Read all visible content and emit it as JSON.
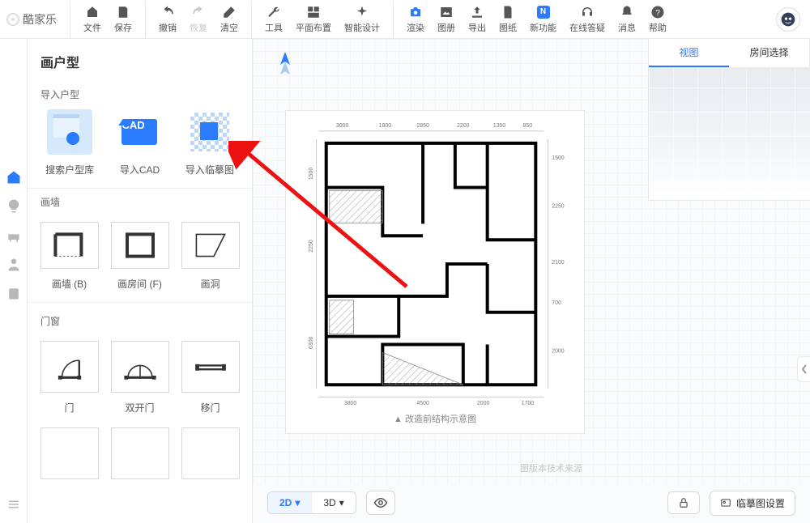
{
  "brand": "酷家乐",
  "toolbar": {
    "file": "文件",
    "save": "保存",
    "undo": "撤销",
    "redo": "恢复",
    "clear": "清空",
    "tools": "工具",
    "layout": "平面布置",
    "ai": "智能设计",
    "render": "渲染",
    "album": "图册",
    "export": "导出",
    "drawing": "图纸",
    "newfeat": "新功能",
    "qa": "在线答疑",
    "msg": "消息",
    "help": "帮助"
  },
  "panel": {
    "title": "画户型",
    "import_section": "导入户型",
    "cards": {
      "search_lib": "搜索户型库",
      "import_cad": "导入CAD",
      "import_trace": "导入临摹图",
      "cad_badge": "CAD"
    },
    "wall_section": "画墙",
    "wall_items": {
      "wall": "画墙 (B)",
      "room": "画房间 (F)",
      "opening": "画洞"
    },
    "door_section": "门窗",
    "door_items": {
      "single": "门",
      "double": "双开门",
      "sliding": "移门"
    }
  },
  "view_tabs": {
    "view": "视图",
    "room_select": "房间选择"
  },
  "floorplan": {
    "caption": "▲ 改造前结构示意图",
    "dims_top": [
      "3000",
      "1800",
      "2850",
      "2200",
      "1350",
      "850"
    ],
    "dims_right": [
      "1500",
      "2250",
      "2100",
      "700",
      "2000"
    ],
    "dims_bottom": [
      "3800",
      "4500",
      "2000",
      "1700"
    ],
    "dims_left": [
      "1500",
      "2250",
      "6300"
    ]
  },
  "bottom": {
    "mode_2d": "2D",
    "mode_3d": "3D",
    "trace_settings": "临摹图设置"
  },
  "watermark": "图版本技术来源"
}
